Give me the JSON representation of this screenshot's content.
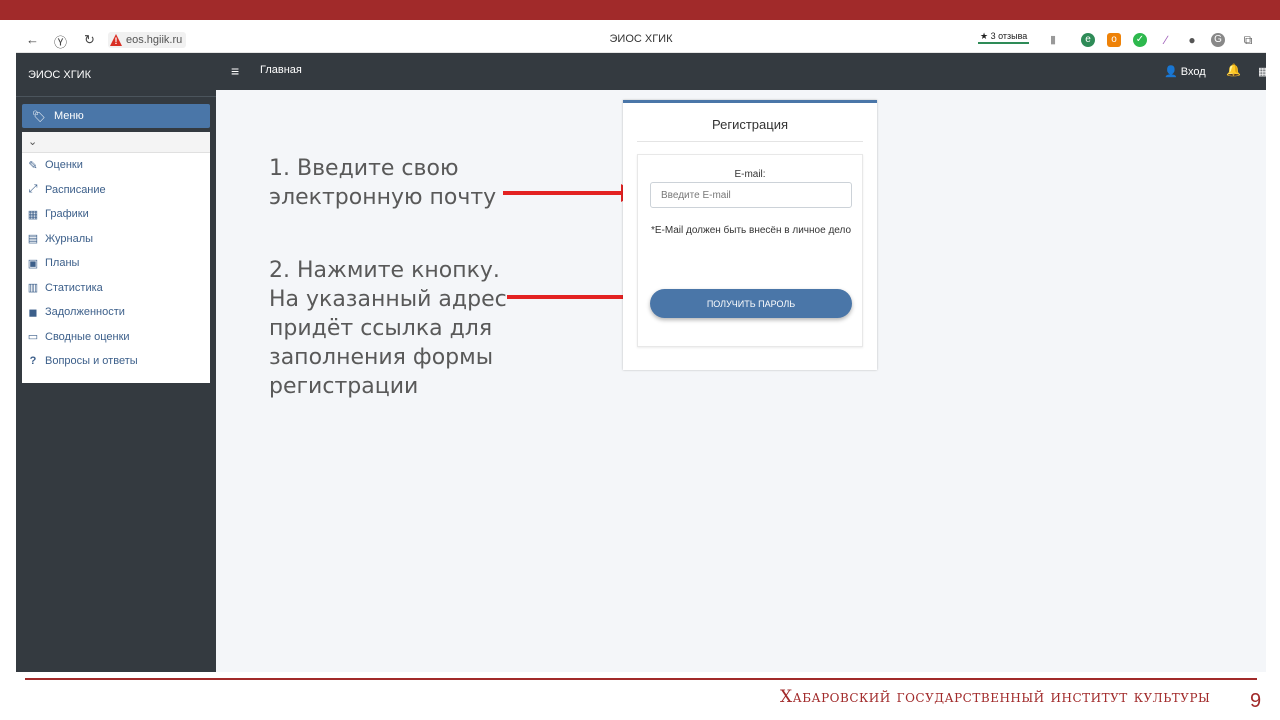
{
  "browser": {
    "back": "←",
    "yandex": "Ⓨ",
    "reload": "↻",
    "warn": "!",
    "url": "eos.hgiik.ru",
    "tab_title": "ЭИОС ХГИК",
    "reviews": "★ 3 отзыва"
  },
  "app": {
    "brand": "ЭИОС ХГИК",
    "header": {
      "hamburger": "≡",
      "home": "Главная",
      "login": "Вход"
    },
    "menu": {
      "title": "Меню",
      "collapse": "⌄",
      "items": [
        {
          "icon": "✎",
          "label": "Оценки"
        },
        {
          "icon": "⤢",
          "label": "Расписание"
        },
        {
          "icon": "▦",
          "label": "Графики"
        },
        {
          "icon": "▤",
          "label": "Журналы"
        },
        {
          "icon": "▣",
          "label": "Планы"
        },
        {
          "icon": "▥",
          "label": "Статистика"
        },
        {
          "icon": "◼",
          "label": "Задолженности"
        },
        {
          "icon": "▭",
          "label": "Сводные оценки"
        },
        {
          "icon": "?",
          "label": "Вопросы и ответы"
        }
      ]
    },
    "registration": {
      "title": "Регистрация",
      "email_label": "E-mail:",
      "email_placeholder": "Введите E-mail",
      "email_value": "",
      "note": "*E-Mail должен быть внесён в личное дело",
      "button": "ПОЛУЧИТЬ ПАРОЛЬ"
    }
  },
  "instructions": {
    "step1": [
      "1. Введите свою",
      "электронную почту"
    ],
    "step2": [
      "2. Нажмите кнопку.",
      "На указанный адрес",
      "придёт ссылка для",
      "заполнения формы",
      "регистрации"
    ]
  },
  "footer": {
    "institute": "Хабаровский государственный институт культуры",
    "page": "9"
  },
  "colors": {
    "accent": "#a12a2a",
    "primary": "#4a76a8",
    "sidebar": "#343a40",
    "arrow": "#e32222"
  }
}
